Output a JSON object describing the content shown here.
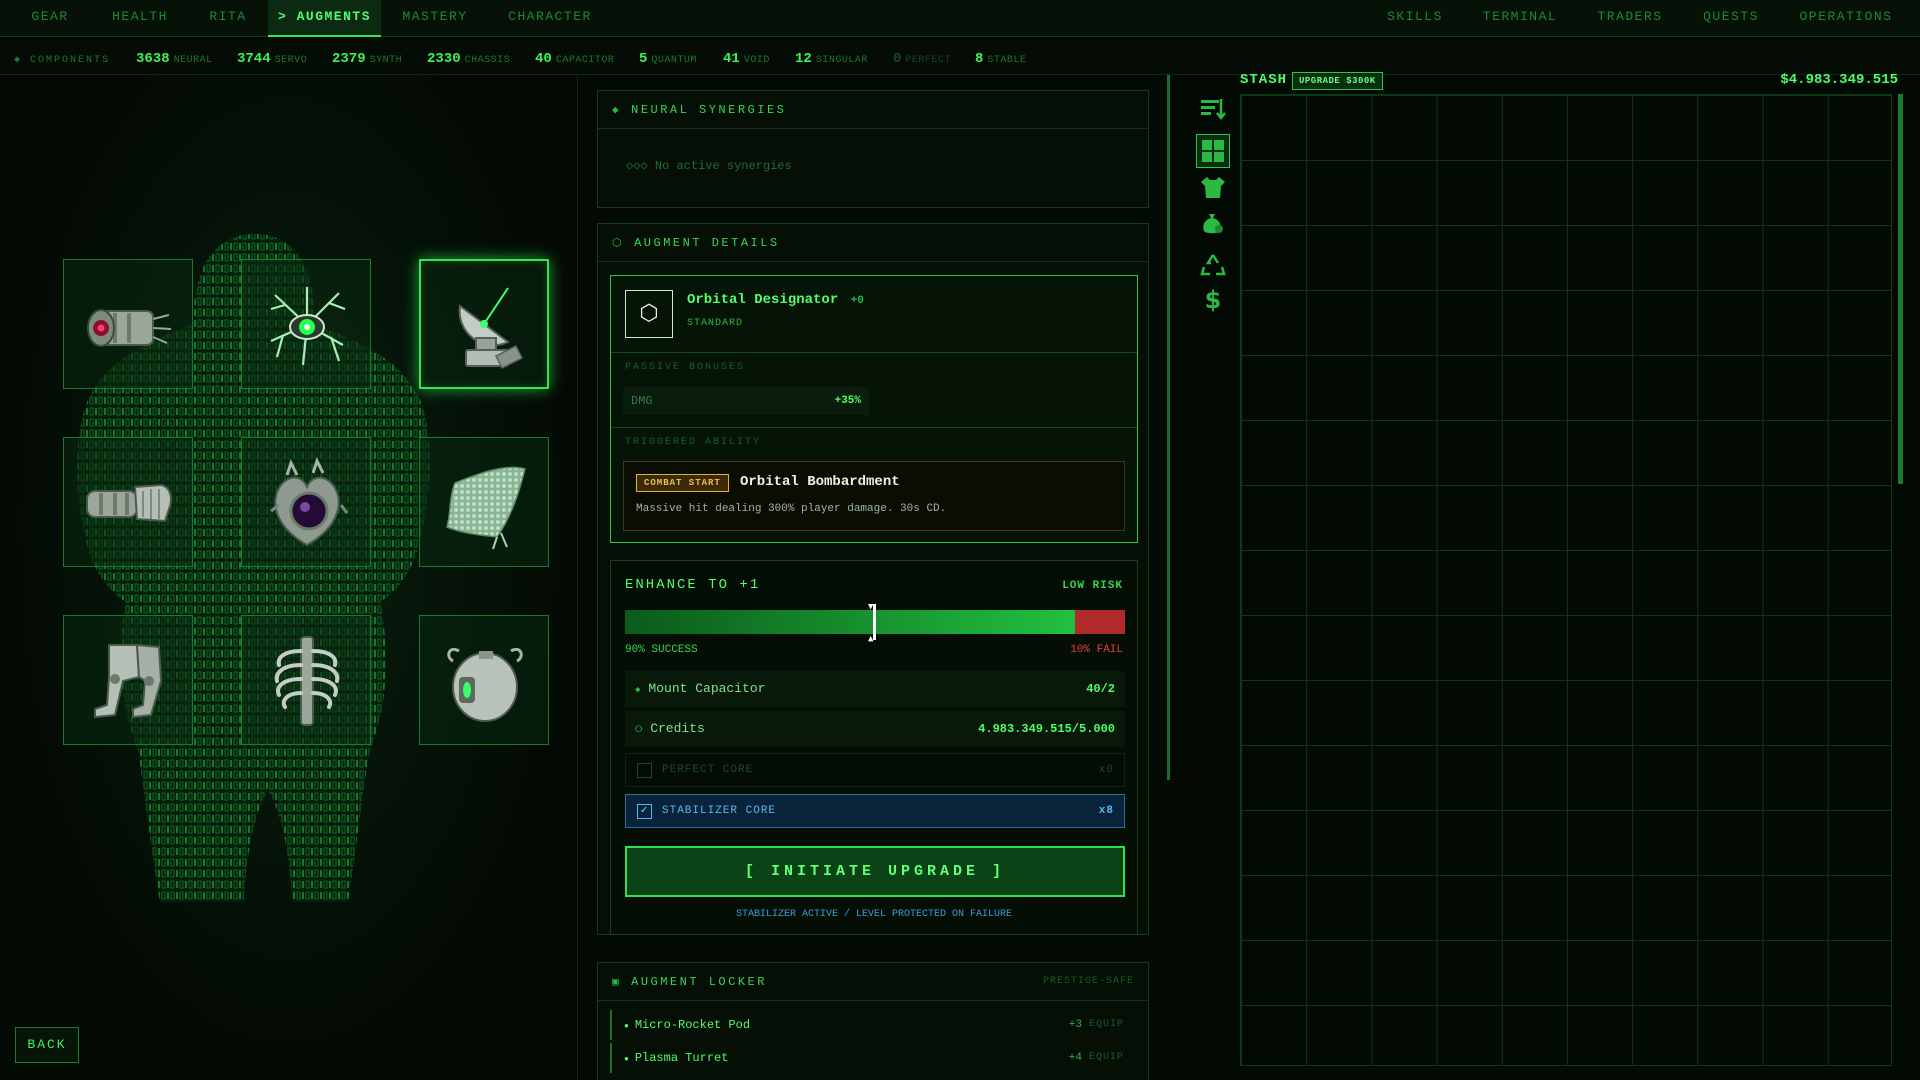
{
  "nav": {
    "left_tabs": [
      {
        "label": "GEAR"
      },
      {
        "label": "HEALTH"
      },
      {
        "label": "RITA"
      },
      {
        "label": "> AUGMENTS"
      },
      {
        "label": "MASTERY"
      },
      {
        "label": "CHARACTER"
      }
    ],
    "active_tab": "> AUGMENTS",
    "right_tabs": [
      {
        "label": "SKILLS"
      },
      {
        "label": "TERMINAL"
      },
      {
        "label": "TRADERS"
      },
      {
        "label": "QUESTS"
      },
      {
        "label": "OPERATIONS"
      }
    ]
  },
  "components": {
    "title": "◆ COMPONENTS",
    "items": [
      {
        "count": "3638",
        "name": "NEURAL"
      },
      {
        "count": "3744",
        "name": "SERVO"
      },
      {
        "count": "2379",
        "name": "SYNTH"
      },
      {
        "count": "2330",
        "name": "CHASSIS"
      },
      {
        "count": "40",
        "name": "CAPACITOR"
      },
      {
        "count": "5",
        "name": "QUANTUM"
      },
      {
        "count": "41",
        "name": "VOID"
      },
      {
        "count": "12",
        "name": "SINGULAR"
      },
      {
        "count": "0",
        "name": "PERFECT"
      },
      {
        "count": "8",
        "name": "STABLE"
      }
    ]
  },
  "character": {
    "slots": [
      {
        "icon": "eye-implant-icon"
      },
      {
        "icon": "neural-core-icon"
      },
      {
        "icon": "satellite-dish-icon",
        "selected": true
      },
      {
        "icon": "cyber-arm-icon"
      },
      {
        "icon": "cyber-heart-icon"
      },
      {
        "icon": "dermal-mesh-icon"
      },
      {
        "icon": "cyber-legs-icon"
      },
      {
        "icon": "spine-ribcage-icon"
      },
      {
        "icon": "power-pack-icon"
      }
    ],
    "back_label": "BACK"
  },
  "synergies": {
    "title": "NEURAL SYNERGIES",
    "empty_text": "◇◇◇ No active synergies"
  },
  "details": {
    "title": "AUGMENT DETAILS",
    "name": "Orbital Designator",
    "level": "+0",
    "tier": "STANDARD",
    "passive_label": "PASSIVE BONUSES",
    "passive": {
      "stat": "DMG",
      "value": "+35%"
    },
    "triggered_label": "TRIGGERED ABILITY",
    "ability": {
      "trigger": "COMBAT START",
      "name": "Orbital Bombardment",
      "desc": "Massive hit dealing 300% player damage. 30s CD."
    }
  },
  "enhance": {
    "title": "ENHANCE TO +1",
    "risk": "LOW RISK",
    "success_label": "90% SUCCESS",
    "fail_label": "10% FAIL",
    "success_fraction": 0.9,
    "requirements": [
      {
        "label": "Mount Capacitor",
        "value": "40/2"
      },
      {
        "label": "Credits",
        "value": "4.983.349.515/5.000"
      }
    ],
    "perfect_core": {
      "label": "PERFECT CORE",
      "count": "x0",
      "checked": false
    },
    "stabilizer_core": {
      "label": "STABILIZER CORE",
      "count": "x8",
      "checked": true
    },
    "button_label": "[ INITIATE UPGRADE ]",
    "note": "STABILIZER ACTIVE / LEVEL PROTECTED ON FAILURE"
  },
  "locker": {
    "title": "AUGMENT LOCKER",
    "tag": "PRESTIGE-SAFE",
    "items": [
      {
        "name": "Micro-Rocket Pod",
        "level": "+3",
        "action": "EQUIP"
      },
      {
        "name": "Plasma Turret",
        "level": "+4",
        "action": "EQUIP"
      }
    ]
  },
  "stash": {
    "title": "STASH",
    "upgrade_label": "UPGRADE $300K",
    "balance": "$4.983.349.515"
  },
  "colors": {
    "accent": "#3ef25a",
    "background": "#030a04",
    "fail_red": "#b02a2a",
    "trigger_amber": "#e0b040",
    "info_blue": "#3a9fd6"
  }
}
